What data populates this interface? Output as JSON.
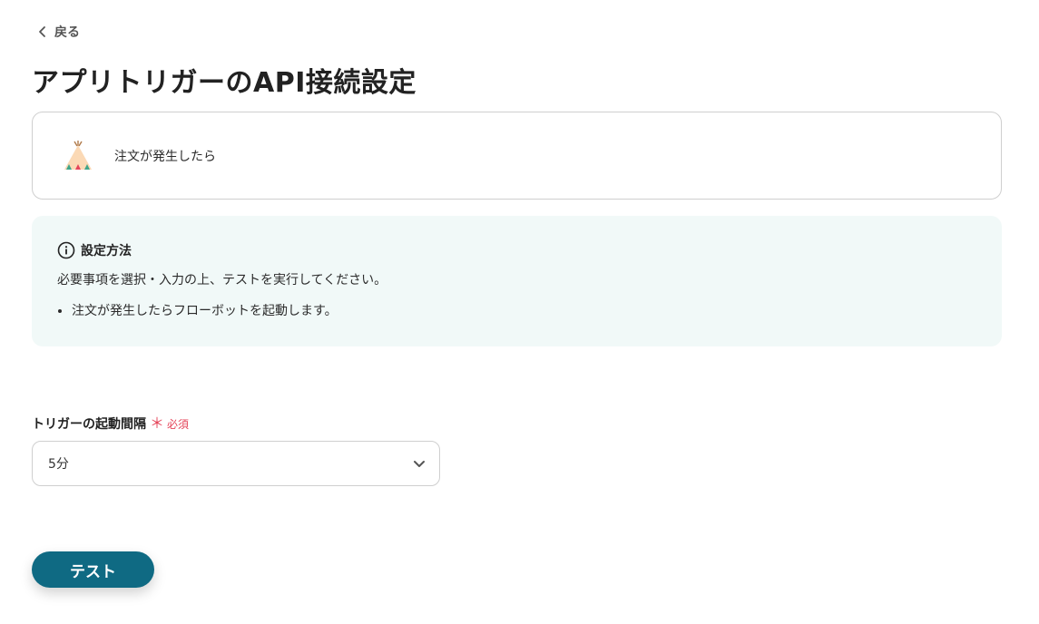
{
  "nav": {
    "back_label": "戻る"
  },
  "page": {
    "title": "アプリトリガーのAPI接続設定"
  },
  "trigger": {
    "label": "注文が発生したら",
    "icon": "teepee-app-icon"
  },
  "info": {
    "heading": "設定方法",
    "description": "必要事項を選択・入力の上、テストを実行してください。",
    "items": [
      "注文が発生したらフローボットを起動します。"
    ]
  },
  "interval_field": {
    "label": "トリガーの起動間隔",
    "required_mark": "＊",
    "required_label": "必須",
    "value": "5分"
  },
  "actions": {
    "test_label": "テスト"
  },
  "colors": {
    "primary": "#0f6a83",
    "info_bg": "#f1f9f8",
    "required": "#e5455a"
  }
}
